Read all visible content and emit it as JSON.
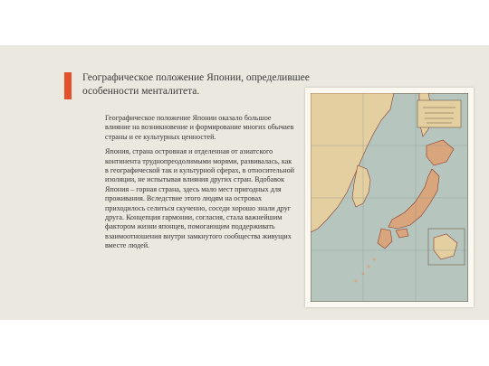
{
  "slide": {
    "title": "Географическое положение Японии, определившее особенности менталитета.",
    "paragraph1": "Географическое положение Японии оказало большое влияние на возникновение и формирование многих обычаев страны и ее культурных ценностей.",
    "paragraph2": "Япония, страна островная и отделенная от азиатского континента труднопреодолимыми морями, развивалась, как в географической так и культурной сферах, в относительной изоляции, не испытывая влияния других стран. Вдобавок Япония – горная страна, здесь мало мест пригодных для проживания. Вследствие этого людям на островах приходилось селиться скученно, соседи хорошо знали друг друга. Концепция гармонии, согласия, стала важнейшим фактором жизни японцев, помогающим поддерживать взаимоотношения внутри замкнутого сообщества живущих вместе людей."
  },
  "map": {
    "colors": {
      "sea": "#b6c6bf",
      "land": "#e4cfa0",
      "japan": "#d9a57c",
      "border": "#8a3b2a"
    }
  }
}
